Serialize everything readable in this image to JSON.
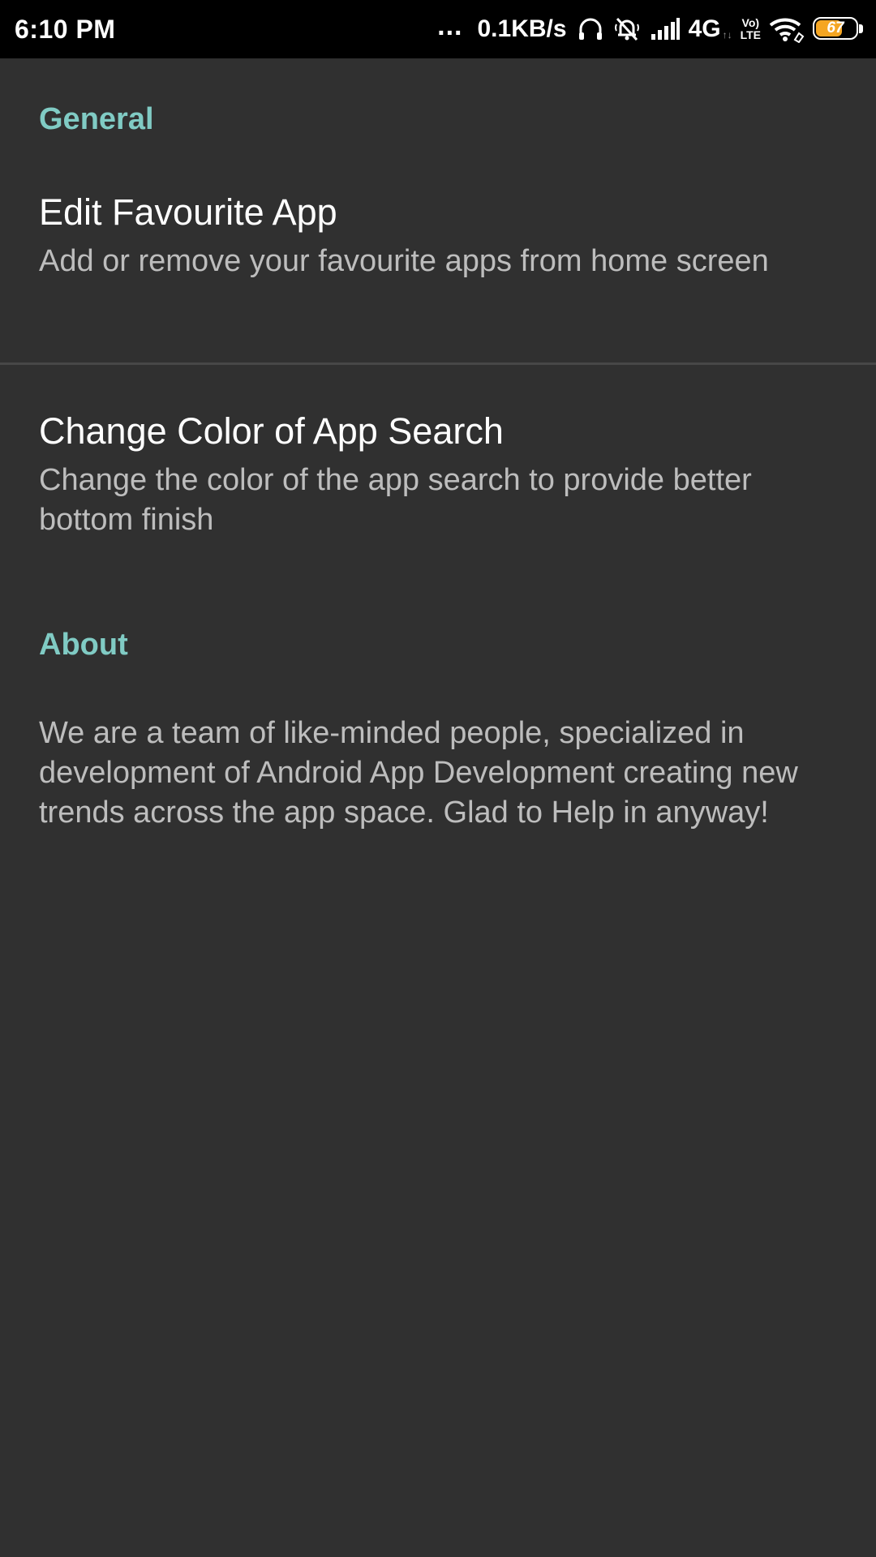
{
  "status_bar": {
    "time": "6:10 PM",
    "more_indicator": "...",
    "net_speed": "0.1KB/s",
    "network_type": "4G",
    "volte_top": "Vo)",
    "volte_bottom": "LTE",
    "battery_level": "67",
    "battery_percent": 67,
    "battery_color": "#f5a623",
    "icons": [
      "headphones-icon",
      "mute-bell-icon",
      "signal-icon",
      "wifi-icon",
      "battery-icon"
    ]
  },
  "colors": {
    "background": "#303030",
    "accent": "#80cbc4",
    "title": "#ffffff",
    "summary": "#bdbdbd"
  },
  "general": {
    "header": "General",
    "items": [
      {
        "title": "Edit Favourite App",
        "summary": "Add or remove your favourite apps from home screen"
      },
      {
        "title": "Change Color of App Search",
        "summary": "Change the color of the app search to provide better bottom finish"
      }
    ]
  },
  "about": {
    "header": "About",
    "text": "We are a team of like-minded people, specialized in development of Android App Development creating new trends across the app space. Glad to Help in anyway!"
  }
}
